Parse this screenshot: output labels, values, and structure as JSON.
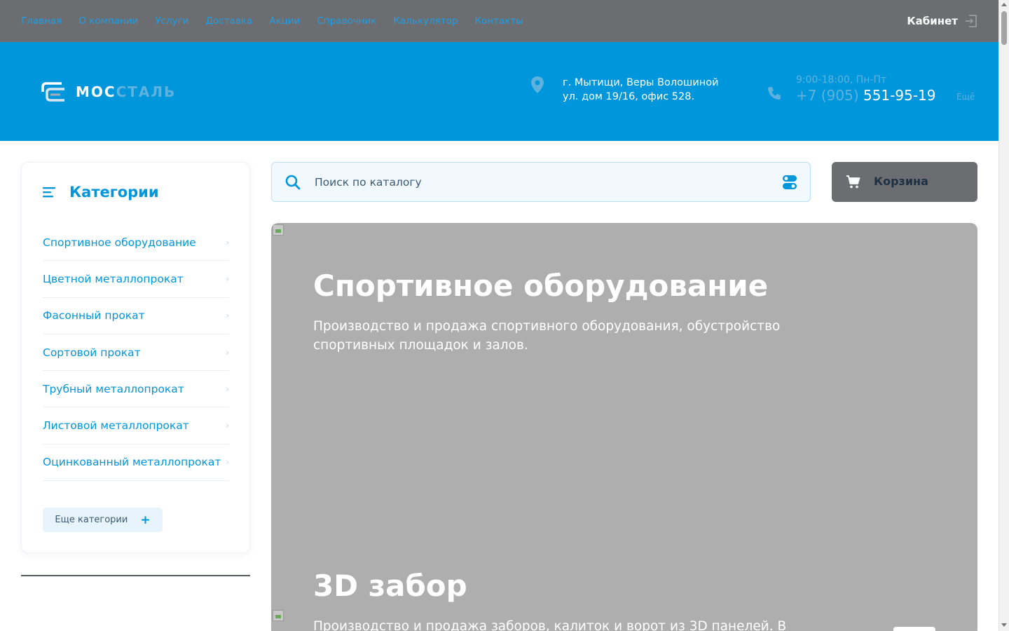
{
  "topnav": {
    "items": [
      "Главная",
      "О компании",
      "Услуги",
      "Доставка",
      "Акции",
      "Справочник",
      "Калькулятор",
      "Контакты"
    ],
    "cabinet_label": "Кабинет",
    "cabinet_icon": "login-icon"
  },
  "header": {
    "logo_part1": "МОС",
    "logo_part2": "СТАЛЬ",
    "address": "г. Мытищи, Веры Волошиной ул. дом 19/16, офис 528.",
    "address_icon": "location-pin-icon",
    "hours": "9:00-18:00, Пн-Пт",
    "phone_prefix": "+7 (905)",
    "phone_number": "551-95-19",
    "phone_icon": "phone-icon",
    "more_label": "Ещё"
  },
  "sidebar": {
    "title": "Категории",
    "title_icon": "menu-lines-icon",
    "categories": [
      "Спортивное оборудование",
      "Цветной металлопрокат",
      "Фасонный прокат",
      "Сортовой прокат",
      "Трубный металлопрокат",
      "Листовой металлопрокат",
      "Оцинкованный металлопрокат"
    ],
    "more_label": "Еще категории",
    "more_icon": "+"
  },
  "search": {
    "placeholder": "Поиск по каталогу",
    "icon": "search-icon",
    "filter_icon": "toggle-filter-icon"
  },
  "cart": {
    "label": "Корзина",
    "icon": "cart-icon"
  },
  "banner": {
    "slides": [
      {
        "title": "Спортивное оборудование",
        "description": "Производство и продажа спортивного оборудования, обустройство спортивных площадок и залов."
      },
      {
        "title": "3D забор",
        "description": "Производство и продажа заборов, калиток и ворот из 3D панелей. В"
      }
    ]
  },
  "colors": {
    "topbar": "#6c6d70",
    "header": "#0096db",
    "accent": "#0096db",
    "banner_bg": "#aeaeae"
  }
}
